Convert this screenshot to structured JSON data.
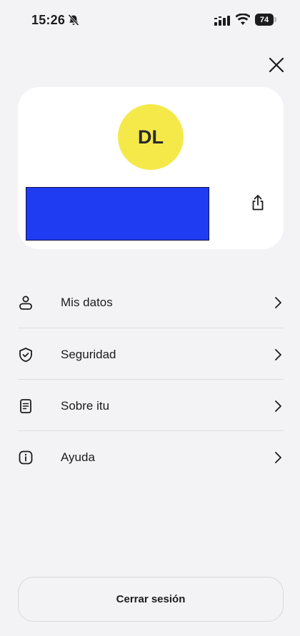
{
  "status_bar": {
    "time": "15:26",
    "battery": "74",
    "icons": [
      "bell-slash-icon",
      "signal-icon",
      "wifi-icon",
      "battery-icon"
    ]
  },
  "header": {
    "close_icon": "close-icon"
  },
  "profile": {
    "initials": "DL",
    "avatar_color": "#f5e94a",
    "redacted_color": "#1f3cf2",
    "share_icon": "share-icon"
  },
  "menu": {
    "items": [
      {
        "label": "Mis datos",
        "icon": "user-icon"
      },
      {
        "label": "Seguridad",
        "icon": "shield-check-icon"
      },
      {
        "label": "Sobre itu",
        "icon": "document-icon"
      },
      {
        "label": "Ayuda",
        "icon": "info-icon"
      }
    ]
  },
  "footer": {
    "logout_label": "Cerrar sesión"
  },
  "colors": {
    "background": "#f3f3f5",
    "card": "#ffffff",
    "text": "#1c1c1e"
  }
}
